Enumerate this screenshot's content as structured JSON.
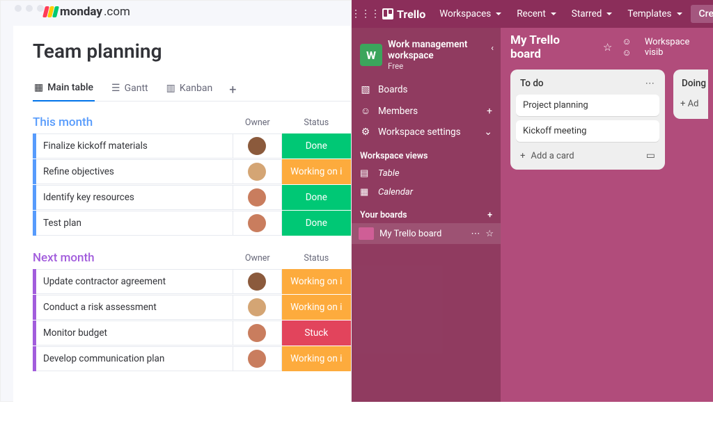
{
  "monday": {
    "brand": "monday",
    "brand_suffix": ".com",
    "title": "Team planning",
    "views": [
      {
        "label": "Main table",
        "icon": "▦",
        "active": true
      },
      {
        "label": "Gantt",
        "icon": "≡"
      },
      {
        "label": "Kanban",
        "icon": "▥"
      }
    ],
    "columns": {
      "owner": "Owner",
      "status": "Status"
    },
    "groups": [
      {
        "name": "This month",
        "color": "#579bfc",
        "tasks": [
          {
            "name": "Finalize kickoff materials",
            "avatar": "av1",
            "status": "Done",
            "status_class": "s-done"
          },
          {
            "name": "Refine objectives",
            "avatar": "av2",
            "status": "Working on i",
            "status_class": "s-working"
          },
          {
            "name": "Identify key resources",
            "avatar": "av3",
            "status": "Done",
            "status_class": "s-done"
          },
          {
            "name": "Test plan",
            "avatar": "av3",
            "status": "Done",
            "status_class": "s-done"
          }
        ]
      },
      {
        "name": "Next month",
        "color": "#a25ddc",
        "tasks": [
          {
            "name": "Update contractor agreement",
            "avatar": "av1",
            "status": "Working on i",
            "status_class": "s-working"
          },
          {
            "name": "Conduct a risk assessment",
            "avatar": "av2",
            "status": "Working on i",
            "status_class": "s-working"
          },
          {
            "name": "Monitor budget",
            "avatar": "av3",
            "status": "Stuck",
            "status_class": "s-stuck"
          },
          {
            "name": "Develop communication plan",
            "avatar": "av3",
            "status": "Working on i",
            "status_class": "s-working"
          }
        ]
      }
    ]
  },
  "trello": {
    "brand": "Trello",
    "top_menus": [
      "Workspaces",
      "Recent",
      "Starred",
      "Templates"
    ],
    "create_label": "Create",
    "workspace": {
      "initial": "W",
      "name": "Work management workspace",
      "plan": "Free"
    },
    "sidebar": {
      "boards": "Boards",
      "members": "Members",
      "settings": "Workspace settings",
      "views_header": "Workspace views",
      "views": [
        {
          "icon": "▤",
          "label": "Table"
        },
        {
          "icon": "cal",
          "label": "Calendar"
        }
      ],
      "your_boards": "Your boards",
      "board_item": "My Trello board"
    },
    "board": {
      "title": "My Trello board",
      "visibility": "Workspace visib",
      "lists": [
        {
          "name": "To do",
          "cards": [
            "Project planning",
            "Kickoff meeting"
          ],
          "add": "Add a card"
        },
        {
          "name": "Doing",
          "add": "+ Ad"
        }
      ]
    }
  }
}
